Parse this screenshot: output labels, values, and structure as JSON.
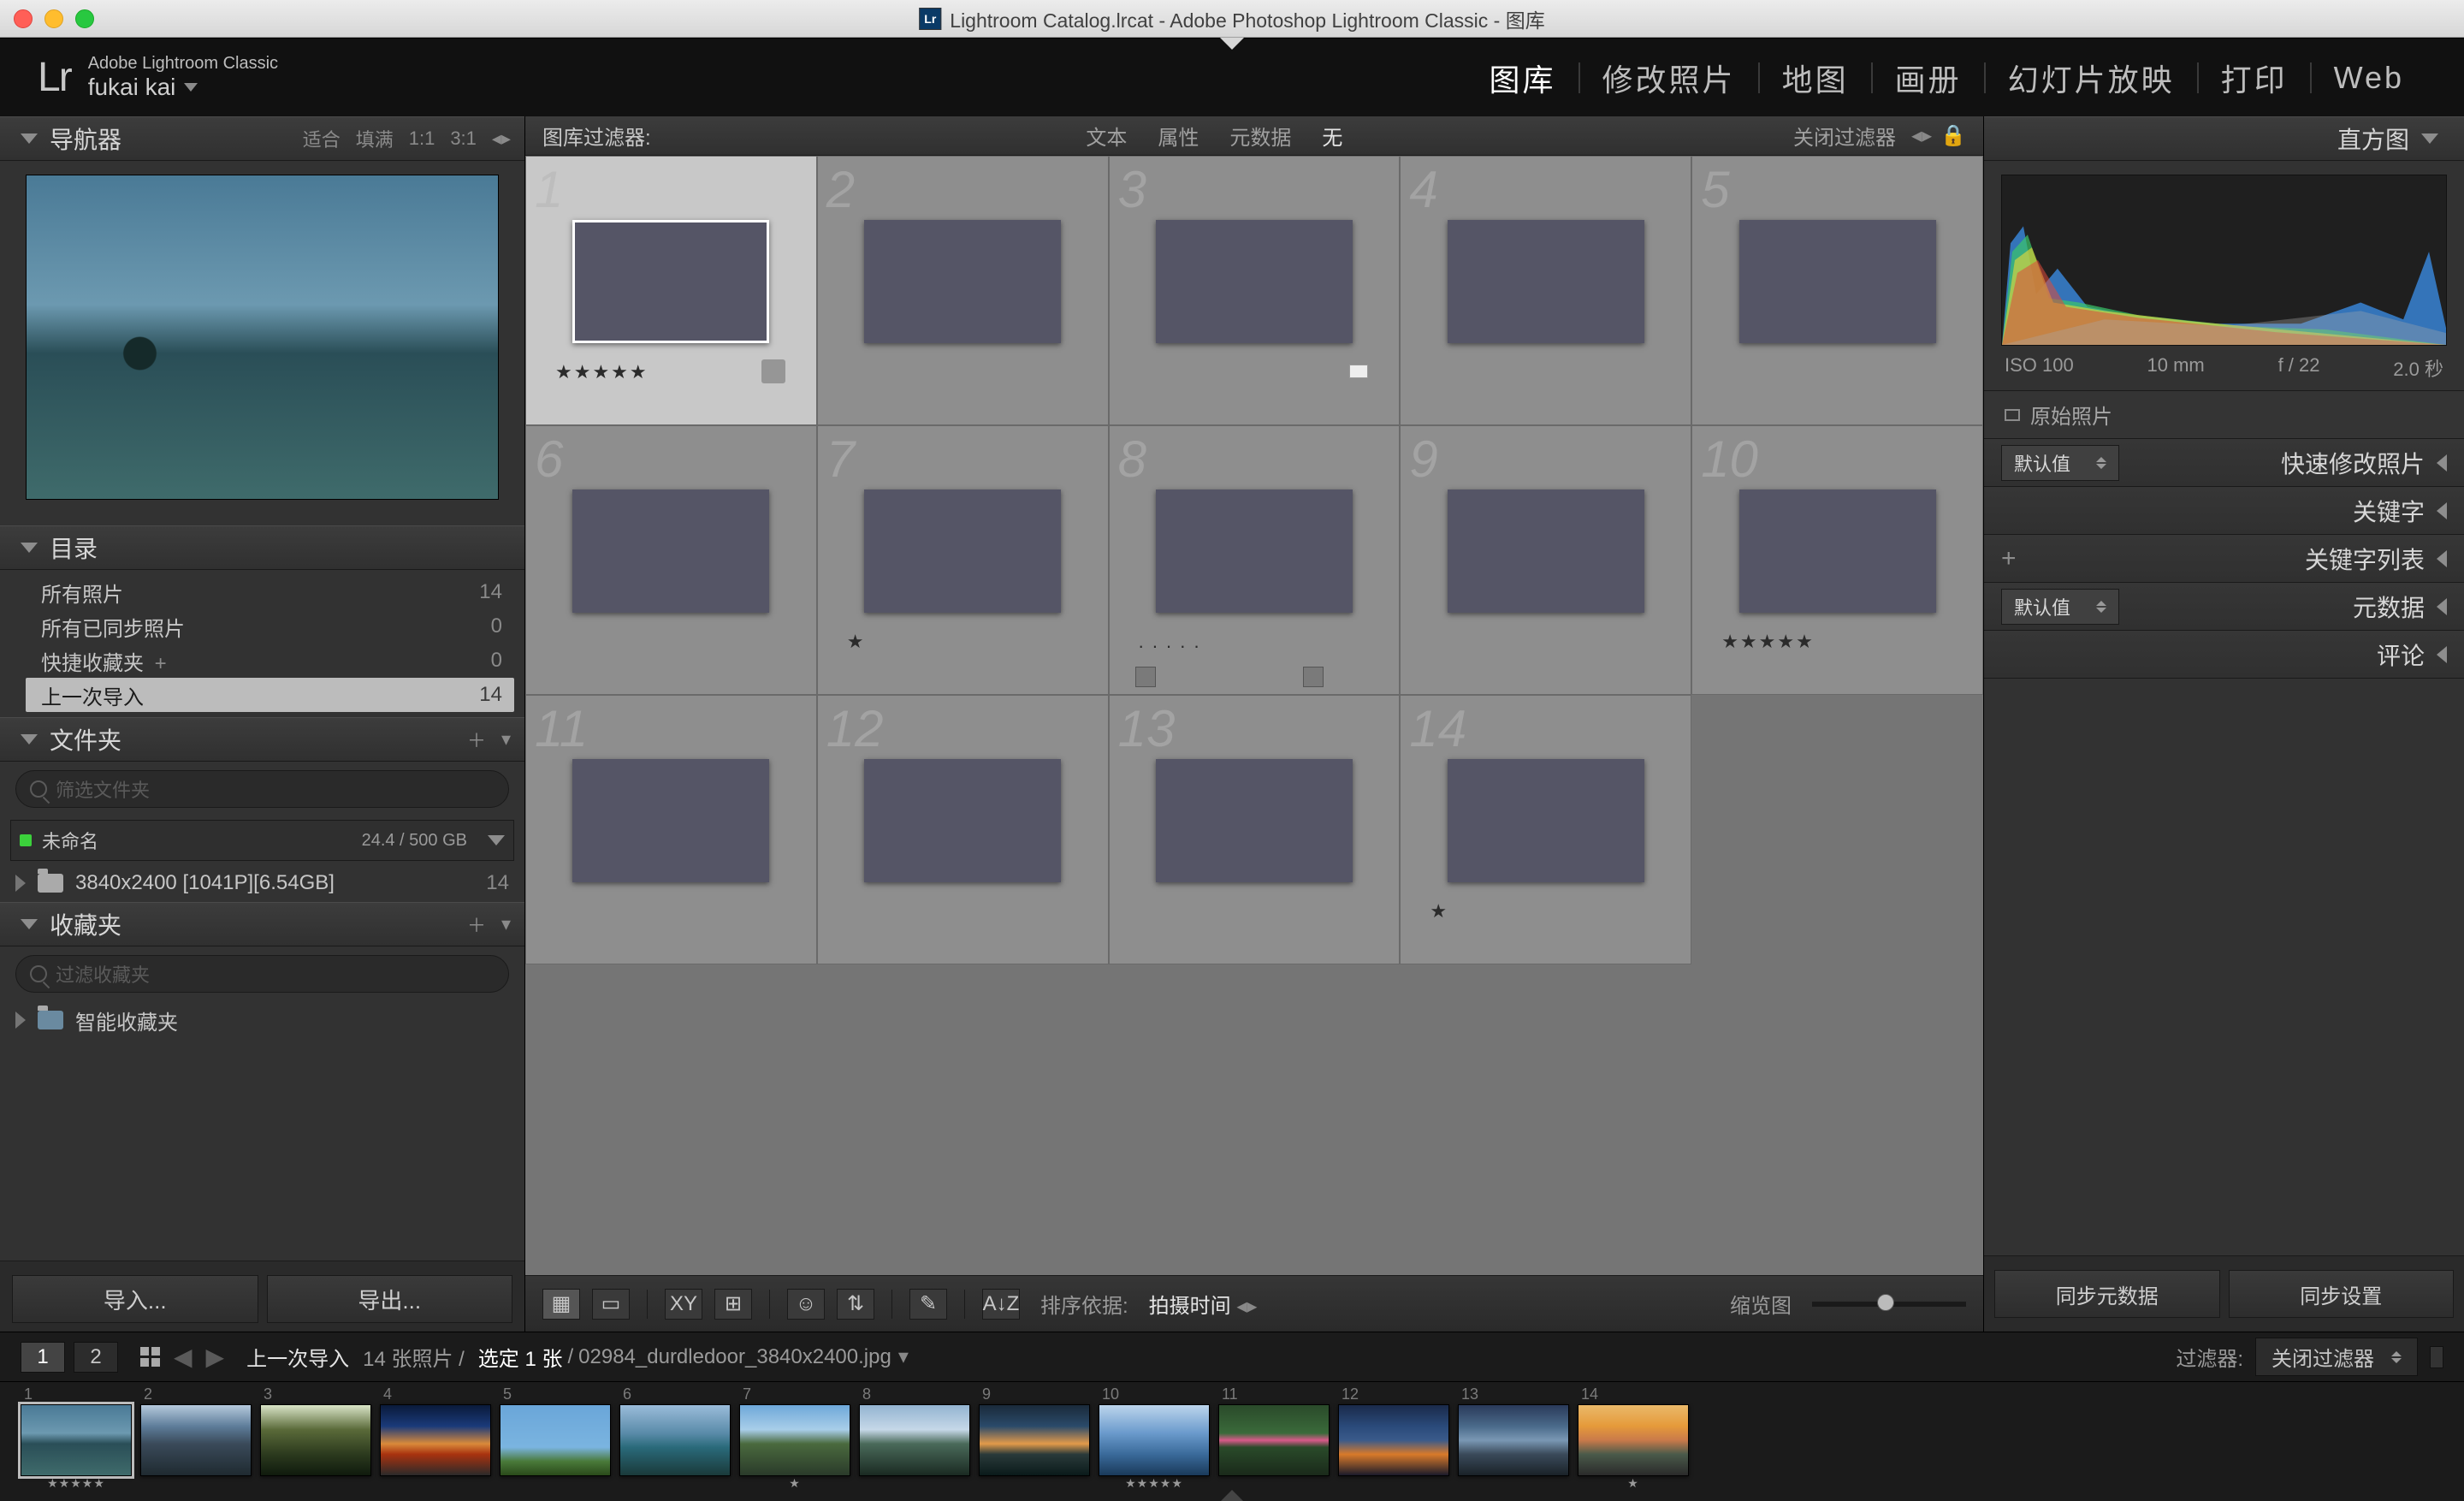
{
  "window": {
    "title": "Lightroom Catalog.lrcat - Adobe Photoshop Lightroom Classic - 图库"
  },
  "brand": {
    "line1": "Adobe Lightroom Classic",
    "line2": "fukai kai"
  },
  "modules": [
    "图库",
    "修改照片",
    "地图",
    "画册",
    "幻灯片放映",
    "打印",
    "Web"
  ],
  "active_module": "图库",
  "navigator": {
    "title": "导航器",
    "options": [
      "适合",
      "填满",
      "1:1",
      "3:1"
    ]
  },
  "catalog": {
    "title": "目录",
    "items": [
      {
        "label": "所有照片",
        "count": "14"
      },
      {
        "label": "所有已同步照片",
        "count": "0"
      },
      {
        "label": "快捷收藏夹",
        "plus": "+",
        "count": "0"
      },
      {
        "label": "上一次导入",
        "count": "14",
        "selected": true
      }
    ]
  },
  "folders": {
    "title": "文件夹",
    "placeholder": "筛选文件夹",
    "volume": "未命名",
    "capacity": "24.4 / 500 GB",
    "folder": "3840x2400 [1041P][6.54GB]",
    "folder_count": "14"
  },
  "collections": {
    "title": "收藏夹",
    "placeholder": "过滤收藏夹",
    "smart": "智能收藏夹"
  },
  "left_buttons": {
    "import": "导入...",
    "export": "导出..."
  },
  "filterbar": {
    "label": "图库过滤器:",
    "items": [
      "文本",
      "属性",
      "元数据",
      "无"
    ],
    "on": "无",
    "close": "关闭过滤器"
  },
  "grid": [
    {
      "n": "1",
      "g": "g1",
      "selected": true,
      "stars": "★★★★★",
      "badge": true
    },
    {
      "n": "2",
      "g": "g2"
    },
    {
      "n": "3",
      "g": "g3",
      "flag": true
    },
    {
      "n": "4",
      "g": "g4"
    },
    {
      "n": "5",
      "g": "g5"
    },
    {
      "n": "6",
      "g": "g6"
    },
    {
      "n": "7",
      "g": "g7",
      "stars": "★"
    },
    {
      "n": "8",
      "g": "g8",
      "stars": ". . . . .",
      "stack": true
    },
    {
      "n": "9",
      "g": "g9"
    },
    {
      "n": "10",
      "g": "g10",
      "stars": "★★★★★"
    },
    {
      "n": "11",
      "g": "g11"
    },
    {
      "n": "12",
      "g": "g12"
    },
    {
      "n": "13",
      "g": "g13"
    },
    {
      "n": "14",
      "g": "g14",
      "stars": "★"
    }
  ],
  "toolbar": {
    "sort_label": "排序依据:",
    "sort_value": "拍摄时间",
    "thumb_label": "缩览图"
  },
  "right": {
    "histogram": "直方图",
    "meta": [
      "ISO 100",
      "10 mm",
      "f / 22",
      "2.0 秒"
    ],
    "orig": "原始照片",
    "quick": "快速修改照片",
    "quick_sel": "默认值",
    "keywording": "关键字",
    "keywordlist": "关键字列表",
    "kl_plus": "+",
    "metadata": "元数据",
    "metadata_sel": "默认值",
    "comments": "评论",
    "sync_meta": "同步元数据",
    "sync_set": "同步设置"
  },
  "infobar": {
    "screen1": "1",
    "screen2": "2",
    "collection": "上一次导入",
    "count": "14 张照片 /",
    "selected": "选定 1 张",
    "sep": "/",
    "file": "02984_durdledoor_3840x2400.jpg",
    "filter_label": "过滤器:",
    "filter_value": "关闭过滤器"
  }
}
